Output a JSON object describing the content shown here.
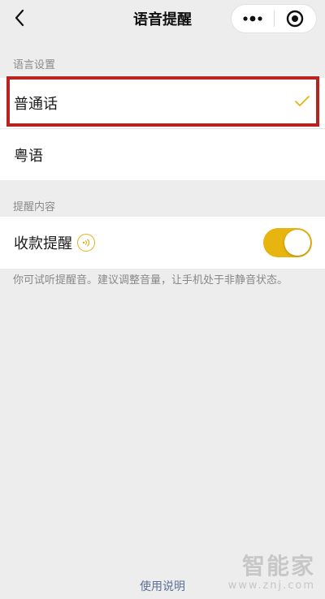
{
  "nav": {
    "title": "语音提醒",
    "back_icon": "chevron-left-icon",
    "more_icon": "more-dots-icon",
    "close_icon": "target-close-icon"
  },
  "language_section": {
    "label": "语言设置",
    "options": [
      {
        "label": "普通话",
        "selected": true
      },
      {
        "label": "粤语",
        "selected": false
      }
    ]
  },
  "content_section": {
    "label": "提醒内容",
    "items": [
      {
        "label": "收款提醒",
        "toggle_on": true
      }
    ]
  },
  "hint_text": "你可试听提醒音。建议调整音量，让手机处于非静音状态。",
  "footer": {
    "link": "使用说明"
  },
  "watermark": {
    "main": "智能家",
    "sub": "www.znj.com"
  },
  "colors": {
    "accent": "#e8b40f",
    "highlight_border": "#b8231f",
    "link": "#5b6f97"
  }
}
